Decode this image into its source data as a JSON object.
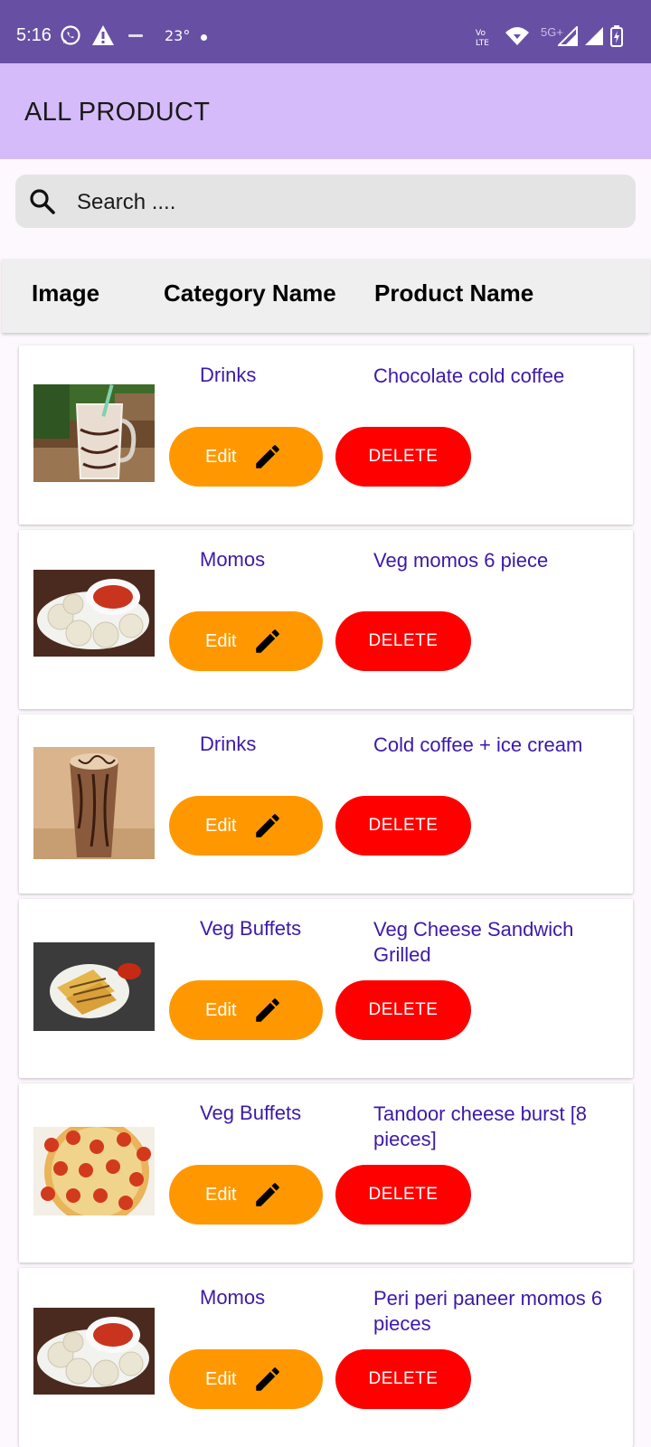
{
  "status_bar": {
    "time": "5:16",
    "temperature": "23°",
    "network": "5G+"
  },
  "app_bar": {
    "title": "ALL PRODUCT"
  },
  "search": {
    "placeholder": "Search ...."
  },
  "table_header": {
    "col_image": "Image",
    "col_category": "Category Name",
    "col_product": "Product Name"
  },
  "products": [
    {
      "category": "Drinks",
      "name": "Chocolate cold coffee",
      "edit_label": "Edit",
      "delete_label": "DELETE"
    },
    {
      "category": "Momos",
      "name": "Veg momos 6 piece",
      "edit_label": "Edit",
      "delete_label": "DELETE"
    },
    {
      "category": "Drinks",
      "name": "Cold coffee + ice cream",
      "edit_label": "Edit",
      "delete_label": "DELETE"
    },
    {
      "category": "Veg Buffets",
      "name": "Veg Cheese Sandwich Grilled",
      "edit_label": "Edit",
      "delete_label": "DELETE"
    },
    {
      "category": "Veg Buffets",
      "name": "Tandoor cheese burst [8 pieces]",
      "edit_label": "Edit",
      "delete_label": "DELETE"
    },
    {
      "category": "Momos",
      "name": "Peri peri paneer momos 6 pieces",
      "edit_label": "Edit",
      "delete_label": "DELETE"
    }
  ],
  "colors": {
    "status_bar": "#6750a4",
    "app_bar": "#d6bbfb",
    "edit_button": "#ff9800",
    "delete_button": "#ff0000",
    "text_accent": "#3d19a8"
  }
}
